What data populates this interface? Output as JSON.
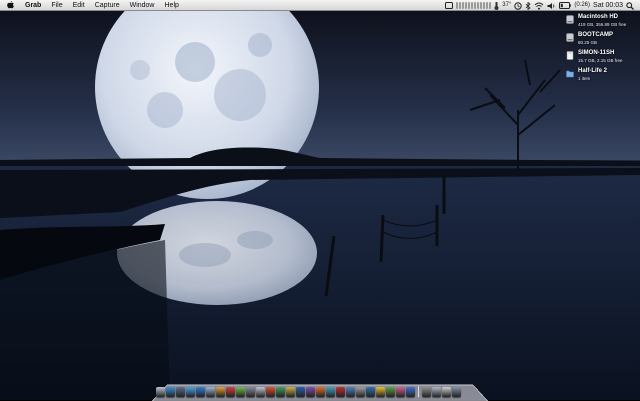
{
  "menubar": {
    "app_name": "Grab",
    "menus": [
      "File",
      "Edit",
      "Capture",
      "Window",
      "Help"
    ],
    "status": {
      "temperature": "37°",
      "battery": "(0:26)",
      "clock": "Sat 00:03"
    }
  },
  "desktop": {
    "volumes": [
      {
        "name": "Macintosh HD",
        "info": "419 GB, 356.89 GB free",
        "icon": "internal-drive-icon"
      },
      {
        "name": "BOOTCAMP",
        "info": "80.25 GB",
        "icon": "internal-drive-icon"
      },
      {
        "name": "SIMON-11SH",
        "info": "15.7 GB, 2.15 GB free",
        "icon": "external-drive-icon"
      },
      {
        "name": "Half-Life 2",
        "info": "1 item",
        "icon": "folder-icon"
      }
    ]
  },
  "dock": {
    "icon_colors": [
      "#b8c6d8",
      "#3a8fd8",
      "#5a6f8e",
      "#4aa3e8",
      "#2f7fd6",
      "#9bb7d4",
      "#e0a030",
      "#d04040",
      "#6fbf4a",
      "#8a8a9a",
      "#c0c8d0",
      "#e05030",
      "#3f9f5f",
      "#d0b040",
      "#2a5fae",
      "#7c4fb0",
      "#e07020",
      "#40a0c0",
      "#c03030",
      "#5080c0",
      "#a0a0a0",
      "#3070b0",
      "#e8c030",
      "#60a040",
      "#d06090",
      "#4070d0",
      "#909090",
      "#b0b8c8",
      "#d0d0d0",
      "#8090a8"
    ]
  },
  "colors": {
    "sky_top": "#0c0e18",
    "sky_bottom": "#30394f",
    "water": "#1d2a3f",
    "moon": "#d6deeb"
  }
}
